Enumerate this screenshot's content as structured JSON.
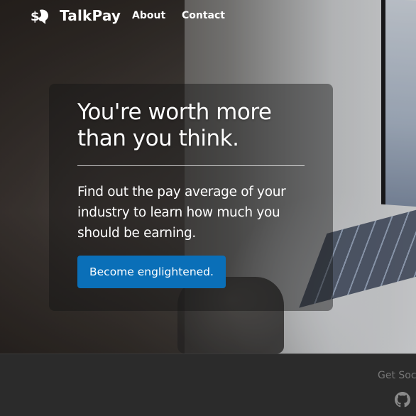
{
  "navbar": {
    "brand_name": "TalkPay",
    "brand_icon": "money-talk-icon",
    "links": [
      {
        "label": "About"
      },
      {
        "label": "Contact"
      }
    ]
  },
  "hero": {
    "headline": "You're worth more than you think.",
    "lead": "Find out the pay average of your industry to learn how much you should be earning.",
    "cta_label": "Become englightened."
  },
  "footer": {
    "social_label": "Get Social",
    "social_icons": [
      "github-icon"
    ]
  },
  "colors": {
    "cta_background": "#0a6fb8",
    "footer_background": "#2b2b2b",
    "text_on_dark": "#ffffff",
    "footer_text": "#777777"
  }
}
